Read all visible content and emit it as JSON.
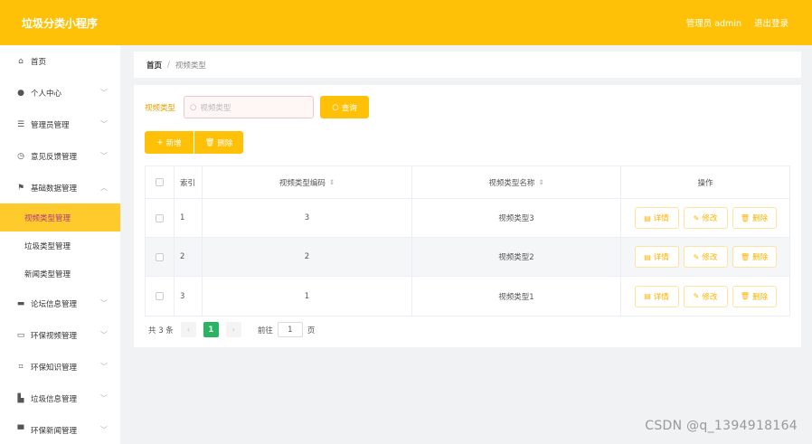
{
  "header": {
    "app_title": "垃圾分类小程序",
    "user_label": "管理员 admin",
    "logout_label": "退出登录"
  },
  "sidebar": {
    "home": "首页",
    "personal_center": "个人中心",
    "admin_manage": "管理员管理",
    "feedback_manage": "意见反馈管理",
    "basic_data_manage": "基础数据管理",
    "sub_items": [
      "视频类型管理",
      "垃圾类型管理",
      "新闻类型管理"
    ],
    "forum_manage": "论坛信息管理",
    "video_manage": "环保视频管理",
    "knowledge_manage": "环保知识管理",
    "garbage_info_manage": "垃圾信息管理",
    "news_manage": "环保新闻管理"
  },
  "breadcrumb": {
    "home": "首页",
    "separator": "/",
    "current": "视频类型"
  },
  "search": {
    "label": "视频类型",
    "placeholder": "视频类型",
    "query_button": "查询"
  },
  "toolbar": {
    "add_button": "新增",
    "delete_button": "删除"
  },
  "table": {
    "headers": {
      "index": "索引",
      "code": "视频类型编码",
      "name": "视频类型名称",
      "ops": "操作"
    },
    "rows": [
      {
        "index": "1",
        "code": "3",
        "name": "视频类型3"
      },
      {
        "index": "2",
        "code": "2",
        "name": "视频类型2"
      },
      {
        "index": "3",
        "code": "1",
        "name": "视频类型1"
      }
    ],
    "op_labels": {
      "detail": "详情",
      "edit": "修改",
      "delete": "删除"
    }
  },
  "pagination": {
    "total": "共 3 条",
    "current_page": "1",
    "goto_label": "前往",
    "goto_value": "1",
    "page_suffix": "页"
  },
  "watermark": "CSDN @q_1394918164",
  "colors": {
    "accent": "#ffc107",
    "active_menu": "#ffca2c",
    "page_active": "#28b463"
  }
}
